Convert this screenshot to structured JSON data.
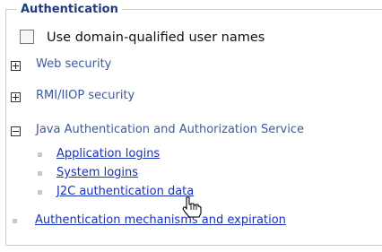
{
  "auth": {
    "legend": "Authentication",
    "checkbox_label": "Use domain-qualified user names",
    "checkbox_checked": false,
    "sections": {
      "web": "Web security",
      "rmi": "RMI/IIOP security",
      "jaas": "Java Authentication and Authorization Service"
    },
    "jaas_links": {
      "app": "Application logins",
      "system": "System logins",
      "j2c": "J2C authentication data"
    },
    "mechanisms_link": "Authentication mechanisms and expiration"
  },
  "colors": {
    "legend": "#1f3b82",
    "section": "#3d5a9c",
    "link": "#1832b8",
    "bullet": "#c8c8c8"
  },
  "icons": {
    "expand": "plus-box-icon",
    "collapse": "minus-box-icon",
    "bullet": "square-bullet-icon",
    "cursor": "hand-pointer-icon"
  }
}
